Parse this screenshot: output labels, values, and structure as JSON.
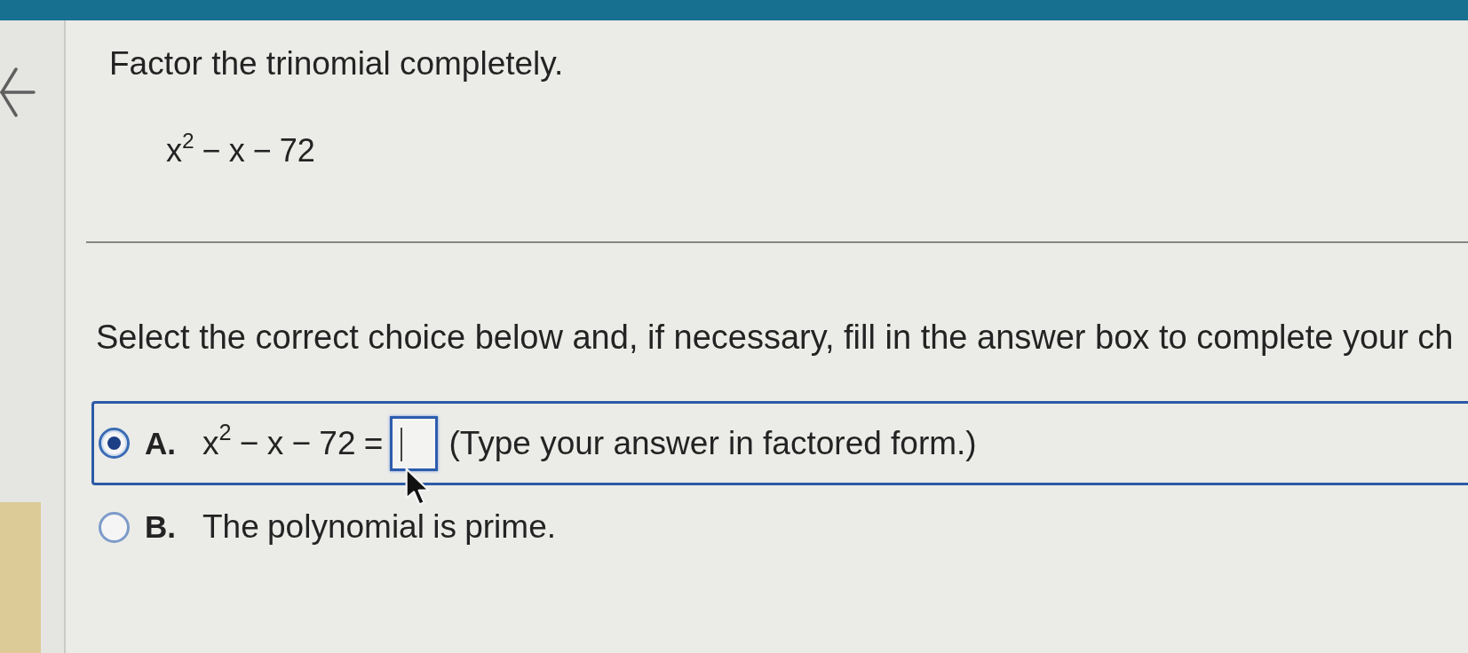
{
  "question": {
    "prompt": "Factor the trinomial completely.",
    "expression": "x$^{2}$ − x − 72"
  },
  "instruction": "Select the correct choice below and, if necessary, fill in the answer box to complete your ch",
  "choices": [
    {
      "kind": "answer",
      "letter": "A.",
      "selected": true,
      "text_before": "x$^{2}$ − x − 72 =",
      "answer_box": {
        "focused": true
      },
      "text_after": "(Type your answer in factored form.)"
    },
    {
      "kind": "statement",
      "letter": "B.",
      "selected": false,
      "text": "The polynomial is prime."
    }
  ]
}
